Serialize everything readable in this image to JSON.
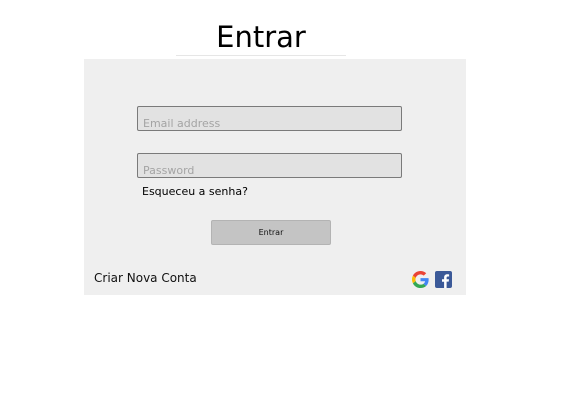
{
  "page": {
    "title": "Entrar"
  },
  "form": {
    "email_placeholder": "Email address",
    "email_value": "",
    "password_placeholder": "Password",
    "password_value": "",
    "forgot_label": "Esqueceu a senha?",
    "submit_label": "Entrar",
    "create_account_label": "Criar Nova Conta"
  },
  "social": {
    "google_icon": "google-icon",
    "facebook_icon": "facebook-icon",
    "google_colors": [
      "#4285F4",
      "#EA4335",
      "#FBBC05",
      "#34A853"
    ],
    "facebook_color": "#3b5998"
  },
  "colors": {
    "panel_background": "#efefef",
    "field_background": "#e2e2e2",
    "button_background": "#c4c4c4"
  }
}
